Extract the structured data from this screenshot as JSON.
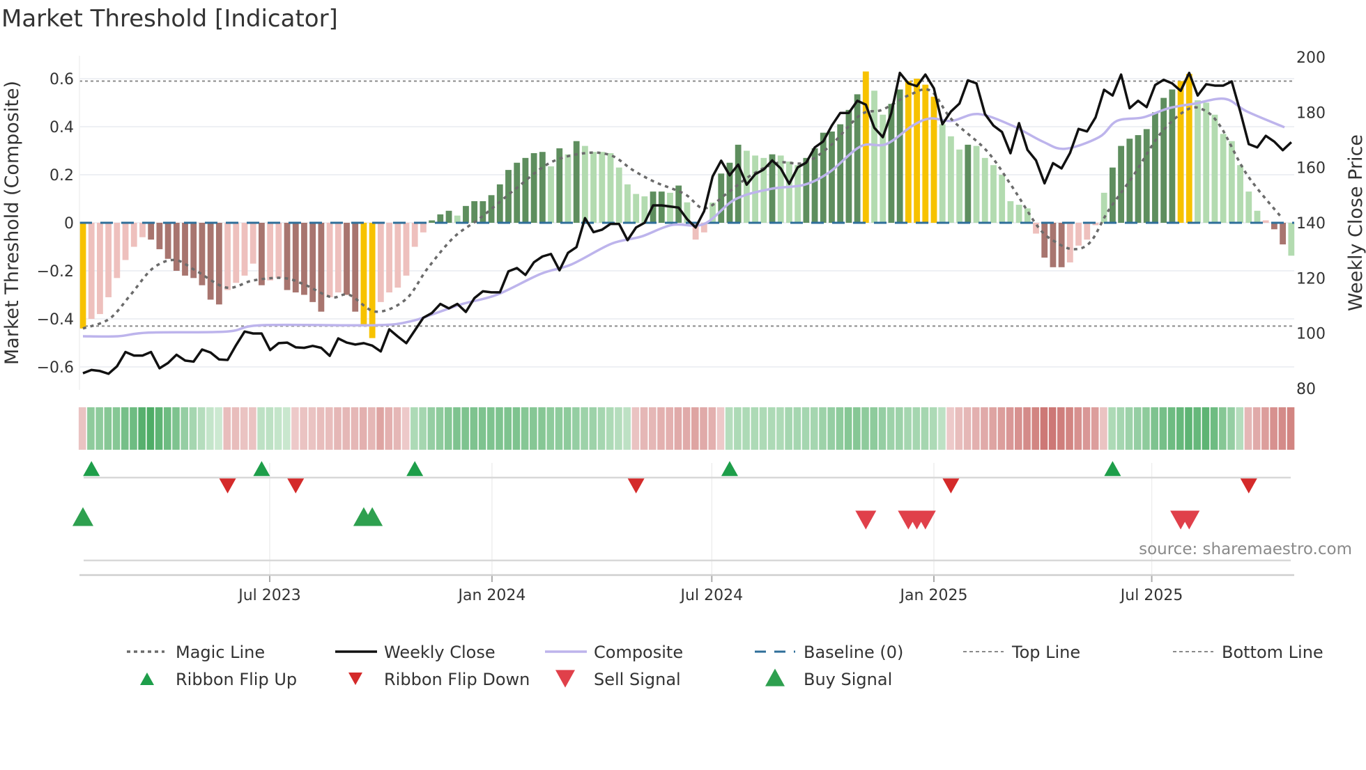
{
  "title": "Market Threshold [Indicator]",
  "source": "source: sharemaestro.com",
  "colors": {
    "bar_rising_pos": "#5e8e5e",
    "bar_falling_pos": "#b3dbb0",
    "bar_falling_neg": "#a8756f",
    "bar_rising_neg": "#eec0bd",
    "bar_signal": "#f7c200",
    "magic": "#6b6b6b",
    "close": "#111111",
    "composite": "#bdb4ec",
    "baseline": "#2e6e99",
    "thresholds": "#8a8a8a",
    "ribbon_up": "#3fa55a",
    "ribbon_down": "#c35f5c",
    "flip_up": "#1e9e4a",
    "flip_down": "#d42a2a",
    "sell": "#e0404a",
    "buy": "#2ea04f"
  },
  "chart_data": {
    "type": "bar+line",
    "title": "Market Threshold [Indicator]",
    "ylabel_left": "Market Threshold (Composite)",
    "ylabel_right": "Weekly Close Price",
    "ylim_left": [
      -0.69,
      0.69
    ],
    "ylim_right": [
      80,
      200
    ],
    "yticks_left": [
      {
        "v": 0.6,
        "label": "0.6"
      },
      {
        "v": 0.4,
        "label": "0.4"
      },
      {
        "v": 0.2,
        "label": "0.2"
      },
      {
        "v": 0,
        "label": "0"
      },
      {
        "v": -0.2,
        "label": "−0.2"
      },
      {
        "v": -0.4,
        "label": "−0.4"
      },
      {
        "v": -0.6,
        "label": "−0.6"
      }
    ],
    "yticks_right": [
      {
        "v": 200,
        "label": "200"
      },
      {
        "v": 180,
        "label": "180"
      },
      {
        "v": 160,
        "label": "160"
      },
      {
        "v": 140,
        "label": "140"
      },
      {
        "v": 120,
        "label": "120"
      },
      {
        "v": 100,
        "label": "100"
      },
      {
        "v": 80,
        "label": "80"
      }
    ],
    "xticks": [
      {
        "week": 21.95,
        "label": "Jul 2023"
      },
      {
        "week": 48.07,
        "label": "Jan 2024"
      },
      {
        "week": 73.9,
        "label": "Jul 2024"
      },
      {
        "week": 100,
        "label": "Jan 2025"
      },
      {
        "week": 125.6,
        "label": "Jul 2025"
      }
    ],
    "top_line": 0.59,
    "bottom_line": -0.43,
    "composite_bars": [
      -0.44,
      -0.4,
      -0.38,
      -0.31,
      -0.23,
      -0.155,
      -0.1,
      -0.06,
      -0.07,
      -0.11,
      -0.15,
      -0.2,
      -0.22,
      -0.23,
      -0.26,
      -0.32,
      -0.34,
      -0.28,
      -0.25,
      -0.22,
      -0.17,
      -0.26,
      -0.24,
      -0.23,
      -0.28,
      -0.29,
      -0.3,
      -0.33,
      -0.37,
      -0.31,
      -0.29,
      -0.3,
      -0.37,
      -0.43,
      -0.48,
      -0.33,
      -0.29,
      -0.27,
      -0.22,
      -0.1,
      -0.04,
      0.01,
      0.035,
      0.05,
      0.03,
      0.07,
      0.09,
      0.09,
      0.115,
      0.16,
      0.22,
      0.25,
      0.27,
      0.29,
      0.295,
      0.235,
      0.31,
      0.285,
      0.34,
      0.32,
      0.295,
      0.295,
      0.29,
      0.23,
      0.16,
      0.12,
      0.11,
      0.13,
      0.13,
      0.125,
      0.155,
      0.085,
      -0.07,
      -0.04,
      0.084,
      0.205,
      0.25,
      0.325,
      0.3,
      0.28,
      0.27,
      0.285,
      0.28,
      0.255,
      0.24,
      0.27,
      0.31,
      0.375,
      0.38,
      0.41,
      0.47,
      0.535,
      0.63,
      0.55,
      0.45,
      0.495,
      0.555,
      0.59,
      0.6,
      0.575,
      0.525,
      0.41,
      0.36,
      0.305,
      0.325,
      0.32,
      0.27,
      0.24,
      0.2,
      0.09,
      0.075,
      0.06,
      -0.045,
      -0.145,
      -0.185,
      -0.185,
      -0.165,
      -0.095,
      -0.07,
      -0.01,
      0.125,
      0.23,
      0.32,
      0.35,
      0.365,
      0.39,
      0.46,
      0.52,
      0.555,
      0.59,
      0.62,
      0.51,
      0.5,
      0.45,
      0.37,
      0.34,
      0.24,
      0.13,
      0.05,
      0.01,
      -0.027,
      -0.09,
      -0.137
    ],
    "bar_states": "YrrrrrrrRRRRRRRRRrrrrRrrRRRRRrrRRYYrrrrrrGGGgGGGGGGGGGGgGgGggggggggGGgGgrrgGGGgggGgggGGGGGGGYggGGYYYYgggGgggggggrRRRrrrrgGGGGGGGGYYggggggggrRR",
    "weekly_close": [
      85.5,
      86.7,
      86.3,
      85.3,
      88,
      93.2,
      91.9,
      91.9,
      93.2,
      87.3,
      89.2,
      92.2,
      90.1,
      89.7,
      94.1,
      93,
      90.5,
      90.3,
      95.7,
      100.6,
      99.9,
      99.9,
      93.9,
      96.4,
      96.6,
      94.9,
      94.7,
      95.4,
      94.7,
      91.8,
      98.1,
      96.6,
      95.9,
      96.4,
      95.5,
      93.4,
      101.4,
      98.8,
      96.4,
      101,
      105.6,
      107.3,
      110.6,
      109,
      110.6,
      107.7,
      112.7,
      115.2,
      114.8,
      114.8,
      122.4,
      123.6,
      121.1,
      125.7,
      127.8,
      128.7,
      122.8,
      129.1,
      131.2,
      141.7,
      136.6,
      137.5,
      139.6,
      139.6,
      133.7,
      138.3,
      140,
      146.3,
      146.3,
      145.9,
      145.5,
      141.3,
      138.3,
      144.2,
      156.8,
      162.5,
      157.2,
      161.1,
      153.8,
      157.6,
      159.3,
      162.6,
      159.7,
      154.1,
      160.1,
      161.8,
      167.3,
      169.5,
      175.2,
      179.8,
      179.8,
      184.2,
      182.8,
      174.4,
      171,
      179.8,
      194.3,
      190.5,
      189.5,
      193.7,
      188.7,
      175.7,
      180.3,
      183.2,
      191.6,
      190.5,
      179.4,
      175.2,
      172.9,
      165.2,
      176.1,
      166.4,
      162.6,
      154.3,
      161.6,
      159.7,
      165.3,
      174,
      173.1,
      178.2,
      188.2,
      186.1,
      193.7,
      181.5,
      184.2,
      181.9,
      189.9,
      191.8,
      190.5,
      187.8,
      194.3,
      186.1,
      190.2,
      189.7,
      189.7,
      191.2,
      180.3,
      168.5,
      167.3,
      171.5,
      169.4,
      166.3,
      169.2
    ],
    "magic_line": [
      [
        0,
        -0.44
      ],
      [
        3.1,
        -0.4
      ],
      [
        5.6,
        -0.3
      ],
      [
        8.2,
        -0.19
      ],
      [
        10.8,
        -0.155
      ],
      [
        13.3,
        -0.2
      ],
      [
        16.9,
        -0.27
      ],
      [
        20,
        -0.24
      ],
      [
        23.6,
        -0.23
      ],
      [
        26.2,
        -0.26
      ],
      [
        29.2,
        -0.31
      ],
      [
        31.3,
        -0.3
      ],
      [
        34.4,
        -0.37
      ],
      [
        37.9,
        -0.32
      ],
      [
        40.5,
        -0.19
      ],
      [
        43.6,
        -0.06
      ],
      [
        46.7,
        0.02
      ],
      [
        50.8,
        0.14
      ],
      [
        54.9,
        0.25
      ],
      [
        59,
        0.29
      ],
      [
        62.1,
        0.28
      ],
      [
        64.6,
        0.22
      ],
      [
        67.2,
        0.17
      ],
      [
        70.7,
        0.12
      ],
      [
        73,
        0.06
      ],
      [
        75.6,
        0.12
      ],
      [
        78.6,
        0.2
      ],
      [
        81.7,
        0.25
      ],
      [
        84.8,
        0.25
      ],
      [
        87.8,
        0.32
      ],
      [
        91.4,
        0.45
      ],
      [
        93.9,
        0.47
      ],
      [
        97,
        0.53
      ],
      [
        99.6,
        0.55
      ],
      [
        102.1,
        0.43
      ],
      [
        106.2,
        0.3
      ],
      [
        109.2,
        0.15
      ],
      [
        112.3,
        -0.02
      ],
      [
        114.3,
        -0.08
      ],
      [
        116.4,
        -0.11
      ],
      [
        118.4,
        -0.08
      ],
      [
        120.5,
        0.05
      ],
      [
        123.5,
        0.2
      ],
      [
        126.6,
        0.37
      ],
      [
        129.7,
        0.47
      ],
      [
        131.7,
        0.47
      ],
      [
        133.7,
        0.4
      ],
      [
        136.8,
        0.2
      ],
      [
        140.9,
        0.02
      ]
    ],
    "composite_line": [
      [
        0,
        98.9
      ],
      [
        4.1,
        98.9
      ],
      [
        7.7,
        100.2
      ],
      [
        16.9,
        100.6
      ],
      [
        21,
        102.9
      ],
      [
        34.4,
        102.9
      ],
      [
        38.5,
        104.3
      ],
      [
        41.5,
        107.3
      ],
      [
        44.6,
        110.6
      ],
      [
        48.7,
        114
      ],
      [
        53.8,
        121.5
      ],
      [
        57.4,
        124.9
      ],
      [
        62.1,
        132.4
      ],
      [
        65.6,
        135
      ],
      [
        69.2,
        139.2
      ],
      [
        73,
        139.6
      ],
      [
        76.6,
        148.4
      ],
      [
        80.7,
        152.2
      ],
      [
        84.8,
        153.8
      ],
      [
        87.8,
        158.5
      ],
      [
        91.4,
        167.7
      ],
      [
        94.4,
        168.5
      ],
      [
        97.5,
        175.2
      ],
      [
        99.6,
        177.8
      ],
      [
        102.1,
        176.9
      ],
      [
        105.2,
        179.4
      ],
      [
        109.2,
        175.2
      ],
      [
        112.8,
        169.4
      ],
      [
        115.4,
        166.8
      ],
      [
        119.4,
        171
      ],
      [
        121.5,
        176.9
      ],
      [
        124.6,
        178.2
      ],
      [
        127.6,
        181.5
      ],
      [
        130.7,
        183.2
      ],
      [
        134.2,
        184.9
      ],
      [
        136.8,
        180.3
      ],
      [
        141.2,
        174.6
      ]
    ],
    "ribbon": [
      -0.2,
      0.5,
      0.5,
      0.55,
      0.55,
      0.65,
      0.7,
      0.85,
      0.9,
      0.8,
      0.7,
      0.6,
      0.45,
      0.35,
      0.25,
      0.15,
      0.1,
      -0.25,
      -0.25,
      -0.2,
      -0.2,
      0.2,
      0.2,
      0.15,
      0.12,
      -0.15,
      -0.2,
      -0.2,
      -0.25,
      -0.25,
      -0.3,
      -0.3,
      -0.3,
      -0.35,
      -0.3,
      -0.45,
      -0.35,
      -0.3,
      -0.15,
      0.3,
      0.35,
      0.45,
      0.5,
      0.55,
      0.6,
      0.6,
      0.6,
      0.6,
      0.6,
      0.6,
      0.6,
      0.6,
      0.55,
      0.55,
      0.55,
      0.5,
      0.5,
      0.5,
      0.45,
      0.4,
      0.4,
      0.35,
      0.3,
      0.25,
      0.2,
      -0.2,
      -0.3,
      -0.3,
      -0.35,
      -0.35,
      -0.4,
      -0.4,
      -0.45,
      -0.4,
      -0.35,
      -0.15,
      0.25,
      0.3,
      0.3,
      0.3,
      0.3,
      0.3,
      0.3,
      0.35,
      0.35,
      0.35,
      0.35,
      0.4,
      0.45,
      0.5,
      0.55,
      0.55,
      0.5,
      0.5,
      0.45,
      0.4,
      0.4,
      0.35,
      0.35,
      0.35,
      0.3,
      0.2,
      -0.15,
      -0.25,
      -0.3,
      -0.35,
      -0.4,
      -0.45,
      -0.5,
      -0.55,
      -0.6,
      -0.65,
      -0.7,
      -0.8,
      -0.8,
      -0.75,
      -0.7,
      -0.6,
      -0.55,
      -0.5,
      -0.2,
      0.3,
      0.35,
      0.4,
      0.45,
      0.5,
      0.6,
      0.65,
      0.7,
      0.75,
      0.8,
      0.75,
      0.8,
      0.7,
      0.55,
      0.45,
      0.25,
      -0.3,
      -0.4,
      -0.5,
      -0.6,
      -0.65,
      -0.7
    ],
    "ribbon_flip_up": [
      1,
      21,
      39,
      76,
      121
    ],
    "ribbon_flip_down": [
      17,
      25,
      65,
      102,
      137
    ],
    "buy_signals": [
      0,
      33,
      34
    ],
    "sell_signals": [
      92,
      97,
      98,
      99,
      129,
      130
    ],
    "legend": {
      "placement": "bottom",
      "items": [
        {
          "key": "magic",
          "label": "Magic Line"
        },
        {
          "key": "close",
          "label": "Weekly Close"
        },
        {
          "key": "composite",
          "label": "Composite"
        },
        {
          "key": "baseline",
          "label": "Baseline (0)"
        },
        {
          "key": "top",
          "label": "Top Line"
        },
        {
          "key": "bottom",
          "label": "Bottom Line"
        },
        {
          "key": "flip_up",
          "label": "Ribbon Flip Up"
        },
        {
          "key": "flip_down",
          "label": "Ribbon Flip Down"
        },
        {
          "key": "sell",
          "label": "Sell Signal"
        },
        {
          "key": "buy",
          "label": "Buy Signal"
        }
      ]
    }
  }
}
